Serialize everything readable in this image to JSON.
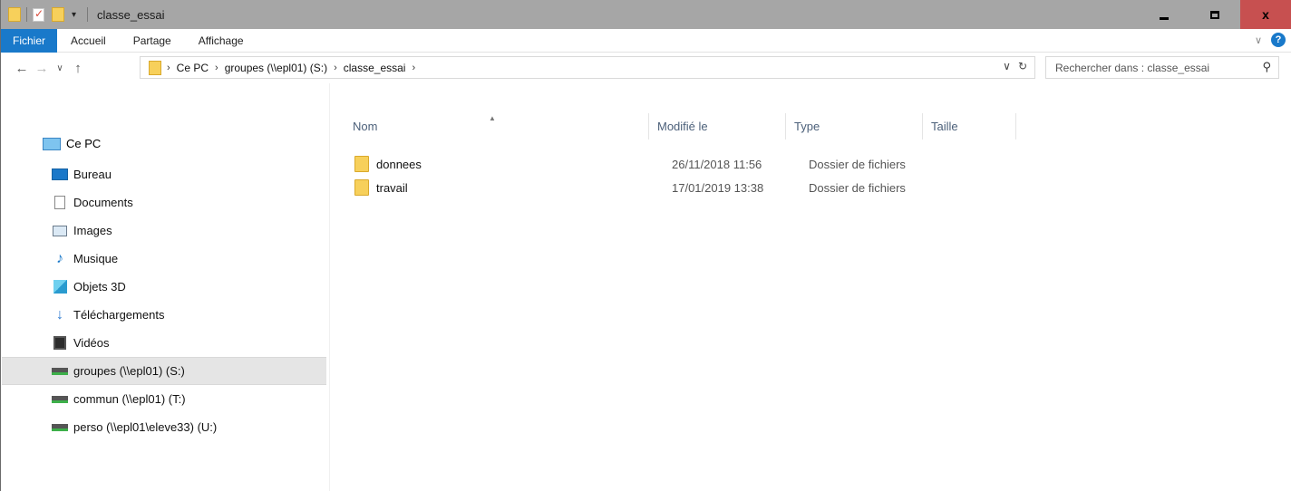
{
  "window": {
    "title": "classe_essai",
    "controls": {
      "minimize_icon": "minimize-icon",
      "maximize_icon": "maximize-icon",
      "close_label": "x"
    }
  },
  "ribbon": {
    "tabs": [
      {
        "label": "Fichier",
        "active": true
      },
      {
        "label": "Accueil"
      },
      {
        "label": "Partage"
      },
      {
        "label": "Affichage"
      }
    ],
    "accent": "#1979ca"
  },
  "address": {
    "breadcrumbs": [
      "Ce PC",
      "groupes (\\\\epl01) (S:)",
      "classe_essai"
    ]
  },
  "search": {
    "placeholder": "Rechercher dans : classe_essai"
  },
  "nav": {
    "this_pc": "Ce PC",
    "items": [
      {
        "label": "Bureau",
        "icon": "desktop-icon"
      },
      {
        "label": "Documents",
        "icon": "documents-icon"
      },
      {
        "label": "Images",
        "icon": "images-icon"
      },
      {
        "label": "Musique",
        "icon": "music-icon"
      },
      {
        "label": "Objets 3D",
        "icon": "objects3d-icon"
      },
      {
        "label": "Téléchargements",
        "icon": "downloads-icon"
      },
      {
        "label": "Vidéos",
        "icon": "videos-icon"
      },
      {
        "label": "groupes (\\\\epl01) (S:)",
        "icon": "network-drive-icon",
        "selected": true
      },
      {
        "label": "commun (\\\\epl01) (T:)",
        "icon": "network-drive-icon"
      },
      {
        "label": "perso (\\\\epl01\\eleve33) (U:)",
        "icon": "network-drive-icon"
      }
    ]
  },
  "list": {
    "columns": [
      "Nom",
      "Modifié le",
      "Type",
      "Taille"
    ],
    "rows": [
      {
        "name": "donnees",
        "modified": "26/11/2018 11:56",
        "type": "Dossier de fichiers",
        "size": ""
      },
      {
        "name": "travail",
        "modified": "17/01/2019 13:38",
        "type": "Dossier de fichiers",
        "size": ""
      }
    ]
  }
}
